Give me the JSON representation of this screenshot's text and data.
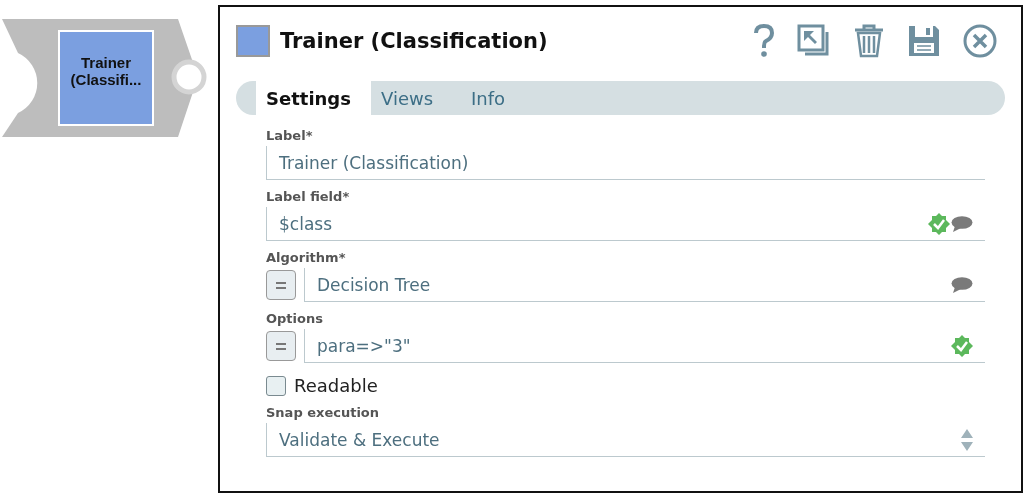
{
  "snap": {
    "label": "Trainer (Classifi..."
  },
  "panel": {
    "title": "Trainer (Classification)",
    "tabs": [
      {
        "label": "Settings",
        "selected": true
      },
      {
        "label": "Views",
        "selected": false
      },
      {
        "label": "Info",
        "selected": false
      }
    ],
    "fields": [
      {
        "kind": "text",
        "label": "Label*",
        "value": "Trainer (Classification)",
        "validated": false,
        "comment": false
      },
      {
        "kind": "text",
        "label": "Label field*",
        "value": "$class",
        "validated": true,
        "comment": true
      },
      {
        "kind": "expression",
        "label": "Algorithm*",
        "value": "Decision Tree",
        "validated": false,
        "comment": true
      },
      {
        "kind": "expression",
        "label": "Options",
        "value": "para=>\"3\"",
        "validated": true,
        "comment": false
      },
      {
        "kind": "checkbox",
        "label": "Readable",
        "checked": false
      },
      {
        "kind": "select",
        "label": "Snap execution",
        "value": "Validate & Execute"
      }
    ]
  }
}
